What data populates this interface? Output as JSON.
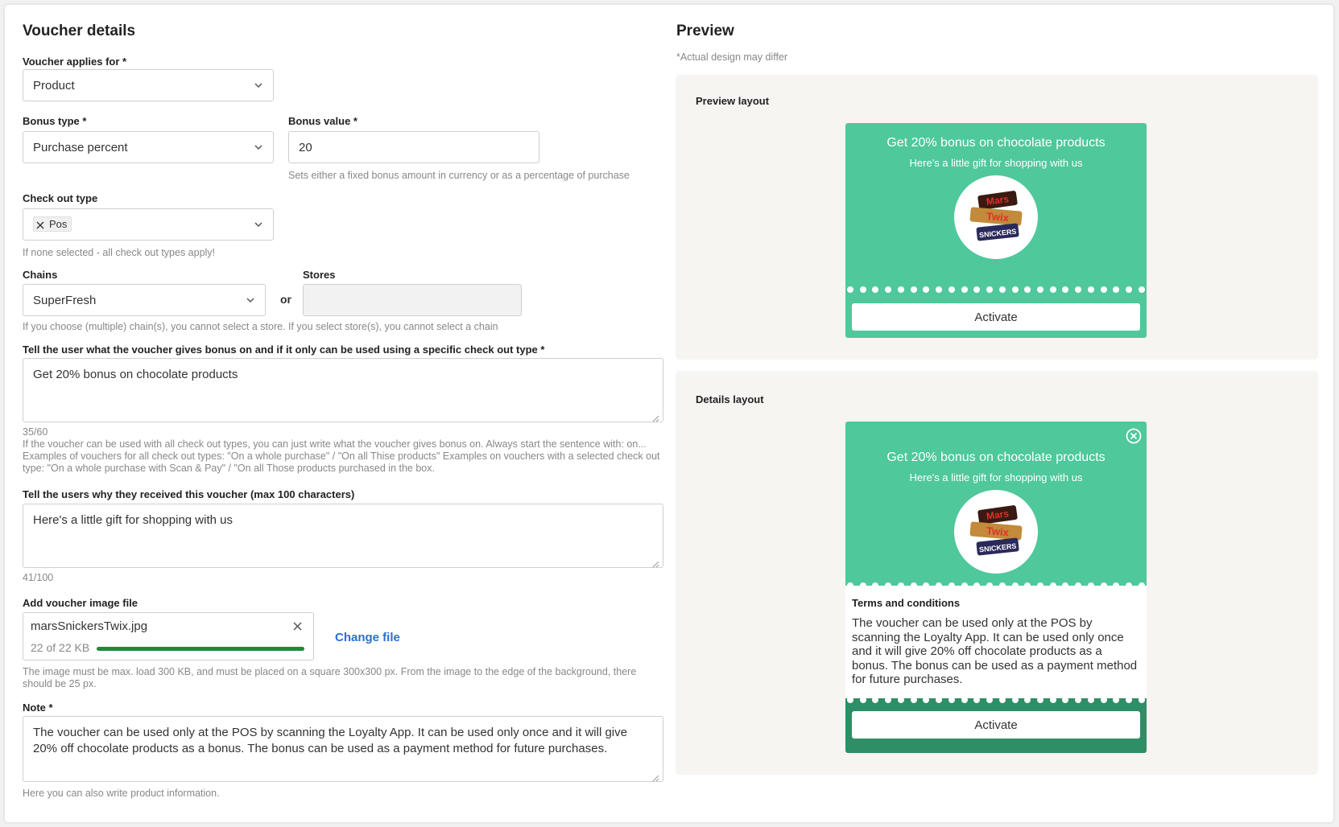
{
  "form": {
    "title": "Voucher details",
    "applies_for": {
      "label": "Voucher applies for *",
      "value": "Product"
    },
    "bonus_type": {
      "label": "Bonus type *",
      "value": "Purchase percent"
    },
    "bonus_value": {
      "label": "Bonus value *",
      "value": "20",
      "hint": "Sets either a fixed bonus amount in currency or as a percentage of purchase"
    },
    "checkout_type": {
      "label": "Check out type",
      "tag": "Pos",
      "hint": "If none selected - all check out types apply!"
    },
    "chains": {
      "label": "Chains",
      "value": "SuperFresh"
    },
    "or_text": "or",
    "stores": {
      "label": "Stores",
      "value": ""
    },
    "chain_store_hint": "If you choose (multiple) chain(s), you cannot select a store. If you select store(s), you cannot select a chain",
    "gives_bonus": {
      "label": "Tell the user what the voucher gives bonus on and if it only can be used using a specific check out type *",
      "value": "Get 20% bonus on chocolate products",
      "counter": "35/60",
      "hint": "If the voucher can be used with all check out types, you can just write what the voucher gives bonus on. Always start the sentence with: on... Examples of vouchers for all check out types: \"On a whole purchase\" / \"On all Thise products\" Examples on vouchers with a selected check out type: \"On a whole purchase with Scan & Pay\" / \"On all Those products purchased in the box."
    },
    "reason": {
      "label": "Tell the users why they received this voucher (max 100 characters)",
      "value": "Here's a little gift for shopping with us",
      "counter": "41/100"
    },
    "image": {
      "label": "Add voucher image file",
      "filename": "marsSnickersTwix.jpg",
      "size": "22 of 22 KB",
      "progress": 1.0,
      "change_label": "Change file",
      "hint": "The image must be max. load 300 KB, and must be placed on a square 300x300 px. From the image to the edge of the background, there should be 25 px."
    },
    "note": {
      "label": "Note *",
      "value": "The voucher can be used only at the POS by scanning the Loyalty App. It can be used only once and it will give 20% off chocolate products as a bonus. The bonus can be used as a payment method for future purchases.",
      "hint": "Here you can also write product information."
    }
  },
  "preview": {
    "title": "Preview",
    "subtitle": "*Actual design may differ",
    "preview_layout_label": "Preview layout",
    "details_layout_label": "Details layout",
    "voucher_title": "Get 20% bonus on chocolate products",
    "voucher_sub": "Here's a little gift for shopping with us",
    "activate_label": "Activate",
    "terms_label": "Terms and conditions",
    "terms_text": "The voucher can be used only at the POS by scanning the Loyalty App. It can be used only once and it will give 20% off chocolate products as a bonus. The bonus can be used as a payment method for future purchases.",
    "product_image_name": "chocolate-bars-image"
  },
  "colors": {
    "voucher_green": "#4fc89b",
    "activate_footer_green": "#2e8f66",
    "progress_green": "#1e8a3a",
    "link_blue": "#2a6fd6"
  },
  "icons": {
    "dropdown": "chevron-down-icon",
    "remove": "close-icon",
    "close_voucher": "close-circle-icon"
  }
}
